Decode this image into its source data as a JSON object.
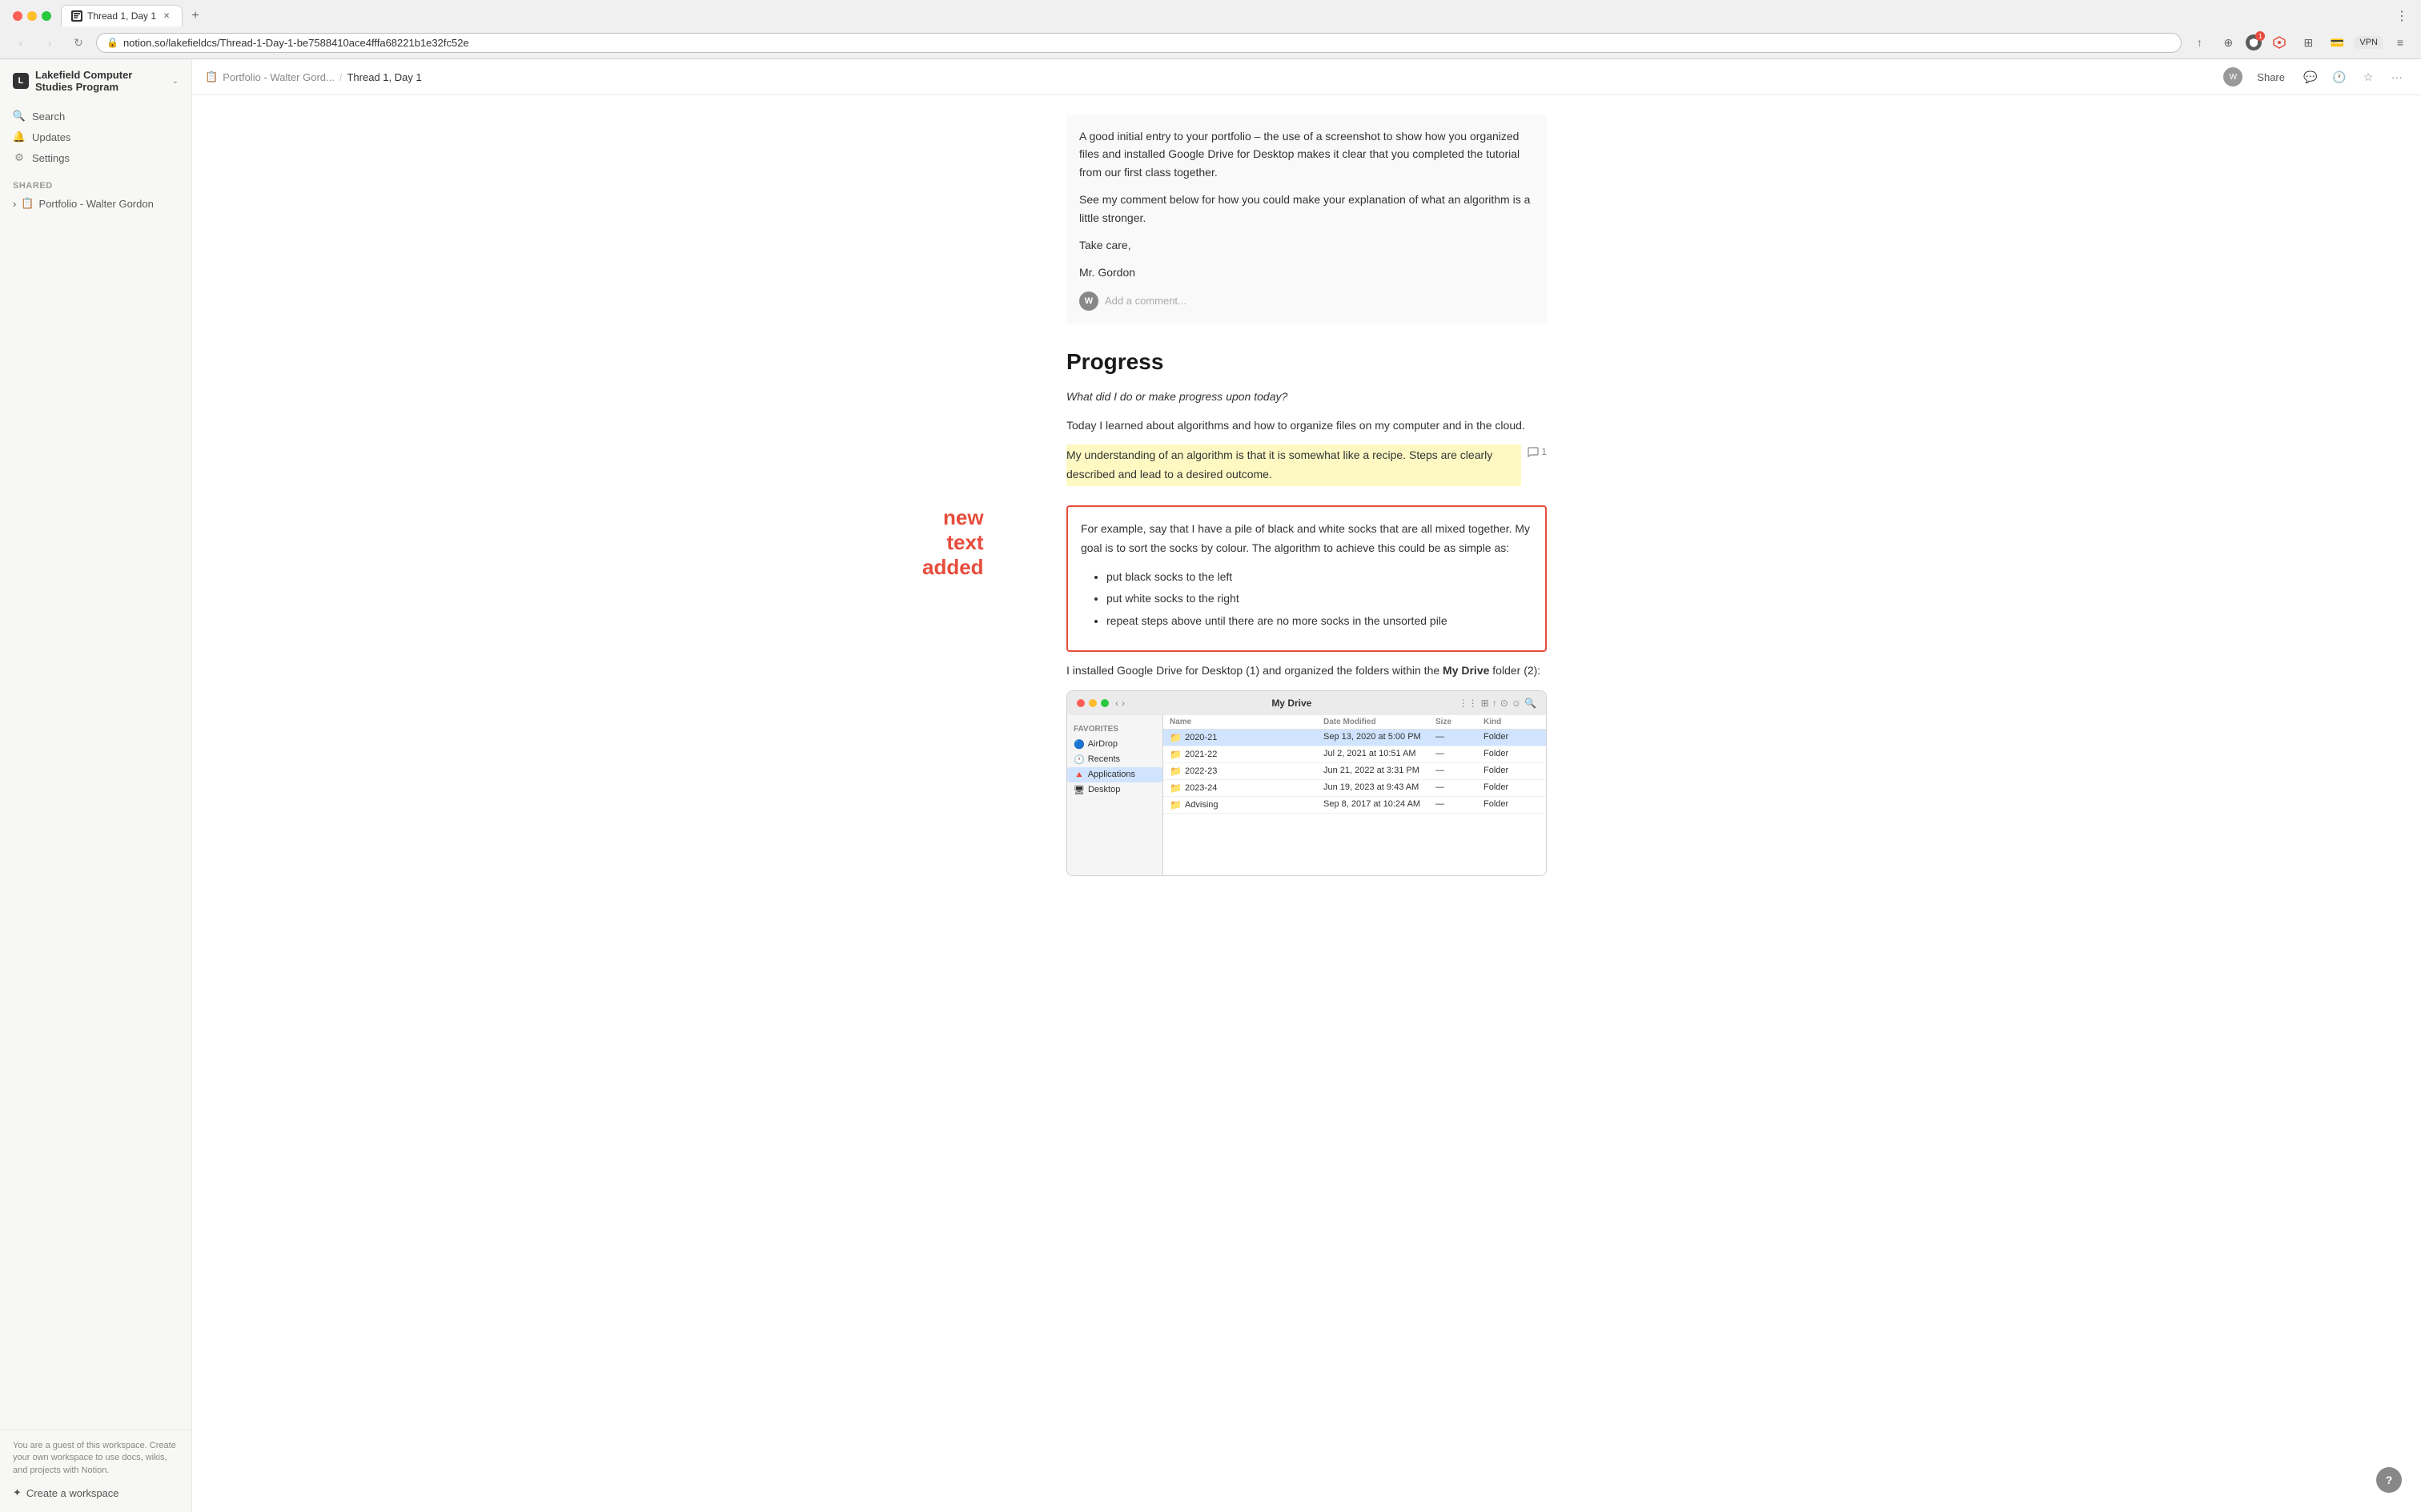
{
  "browser": {
    "tab_title": "Thread 1, Day 1",
    "tab_favicon": "notion",
    "url": "notion.so/lakefieldcs/Thread-1-Day-1-be7588410ace4fffa68221b1e32fc52e",
    "new_tab_btn": "+",
    "nav_back": "‹",
    "nav_forward": "›",
    "nav_refresh": "↻",
    "share_icon": "↑",
    "bookmark_icon": "⊕",
    "shield_count": "1",
    "vpn_label": "VPN"
  },
  "sidebar": {
    "workspace_icon": "L",
    "workspace_name": "Lakefield Computer Studies Program",
    "workspace_chevron": "⌄",
    "nav_items": [
      {
        "id": "search",
        "label": "Search",
        "icon": "🔍"
      },
      {
        "id": "updates",
        "label": "Updates",
        "icon": "🔔"
      },
      {
        "id": "settings",
        "label": "Settings",
        "icon": "⚙"
      }
    ],
    "shared_section_label": "Shared",
    "pages": [
      {
        "id": "portfolio-walter-gordon",
        "icon": "📋",
        "label": "Portfolio - Walter Gordon"
      }
    ],
    "footer_text": "You are a guest of this workspace. Create your own workspace to use docs, wikis, and projects with Notion.",
    "create_workspace_label": "Create a workspace",
    "create_workspace_icon": "✦"
  },
  "page_header": {
    "breadcrumb_icon": "📋",
    "breadcrumb_parent": "Portfolio - Walter Gord...",
    "breadcrumb_sep": "/",
    "breadcrumb_current": "Thread 1, Day 1",
    "avatar_label": "W",
    "share_label": "Share",
    "comment_icon": "💬",
    "history_icon": "🕐",
    "favorite_icon": "☆",
    "more_icon": "···"
  },
  "content": {
    "comment_block": {
      "paragraphs": [
        "A good initial entry to your portfolio – the use of a screenshot to show how you organized files and installed Google Drive for Desktop makes it clear that you completed the tutorial from our first class together.",
        "See my comment below for how you could make your explanation of what an algorithm is a little stronger.",
        "Take care,",
        "Mr. Gordon"
      ],
      "add_comment_placeholder": "Add a comment...",
      "comment_avatar": "W"
    },
    "section_heading": "Progress",
    "italic_question": "What did I do or make progress upon today?",
    "para1": "Today I learned about algorithms and how to organize files on my computer and in the cloud.",
    "highlighted_text": "My understanding of an algorithm is that it is somewhat like a recipe. Steps are clearly described and lead to a desired outcome.",
    "comment_count": "1",
    "red_box": {
      "intro": "For example, say that I have a pile of black and white socks that are all mixed together. My goal is to sort the socks by colour. The algorithm to achieve this could be as simple as:",
      "bullets": [
        "put black socks to the left",
        "put white socks to the right",
        "repeat steps above until there are no more socks in the unsorted pile"
      ]
    },
    "annotation": {
      "lines": [
        "new",
        "text",
        "added"
      ]
    },
    "para2_start": "I installed Google Drive for Desktop (1) and organized the folders within the ",
    "para2_bold": "My Drive",
    "para2_end": " folder (2):"
  },
  "finder": {
    "title": "My Drive",
    "sidebar_section": "Favorites",
    "sidebar_items": [
      {
        "icon": "🔵",
        "label": "AirDrop"
      },
      {
        "icon": "🕐",
        "label": "Recents"
      },
      {
        "icon": "🔺",
        "label": "Applications",
        "active": true
      },
      {
        "icon": "🖥",
        "label": "Desktop"
      }
    ],
    "table_headers": [
      "Name",
      "Date Modified",
      "Size",
      "Kind"
    ],
    "rows": [
      {
        "name": "2020-21",
        "date": "Sep 13, 2020 at 5:00 PM",
        "size": "—",
        "kind": "Folder",
        "highlighted": true
      },
      {
        "name": "2021-22",
        "date": "Jul 2, 2021 at 10:51 AM",
        "size": "—",
        "kind": "Folder"
      },
      {
        "name": "2022-23",
        "date": "Jun 21, 2022 at 3:31 PM",
        "size": "—",
        "kind": "Folder"
      },
      {
        "name": "2023-24",
        "date": "Jun 19, 2023 at 9:43 AM",
        "size": "—",
        "kind": "Folder"
      },
      {
        "name": "Advising",
        "date": "Sep 8, 2017 at 10:24 AM",
        "size": "—",
        "kind": "Folder"
      }
    ]
  },
  "help_btn": "?"
}
